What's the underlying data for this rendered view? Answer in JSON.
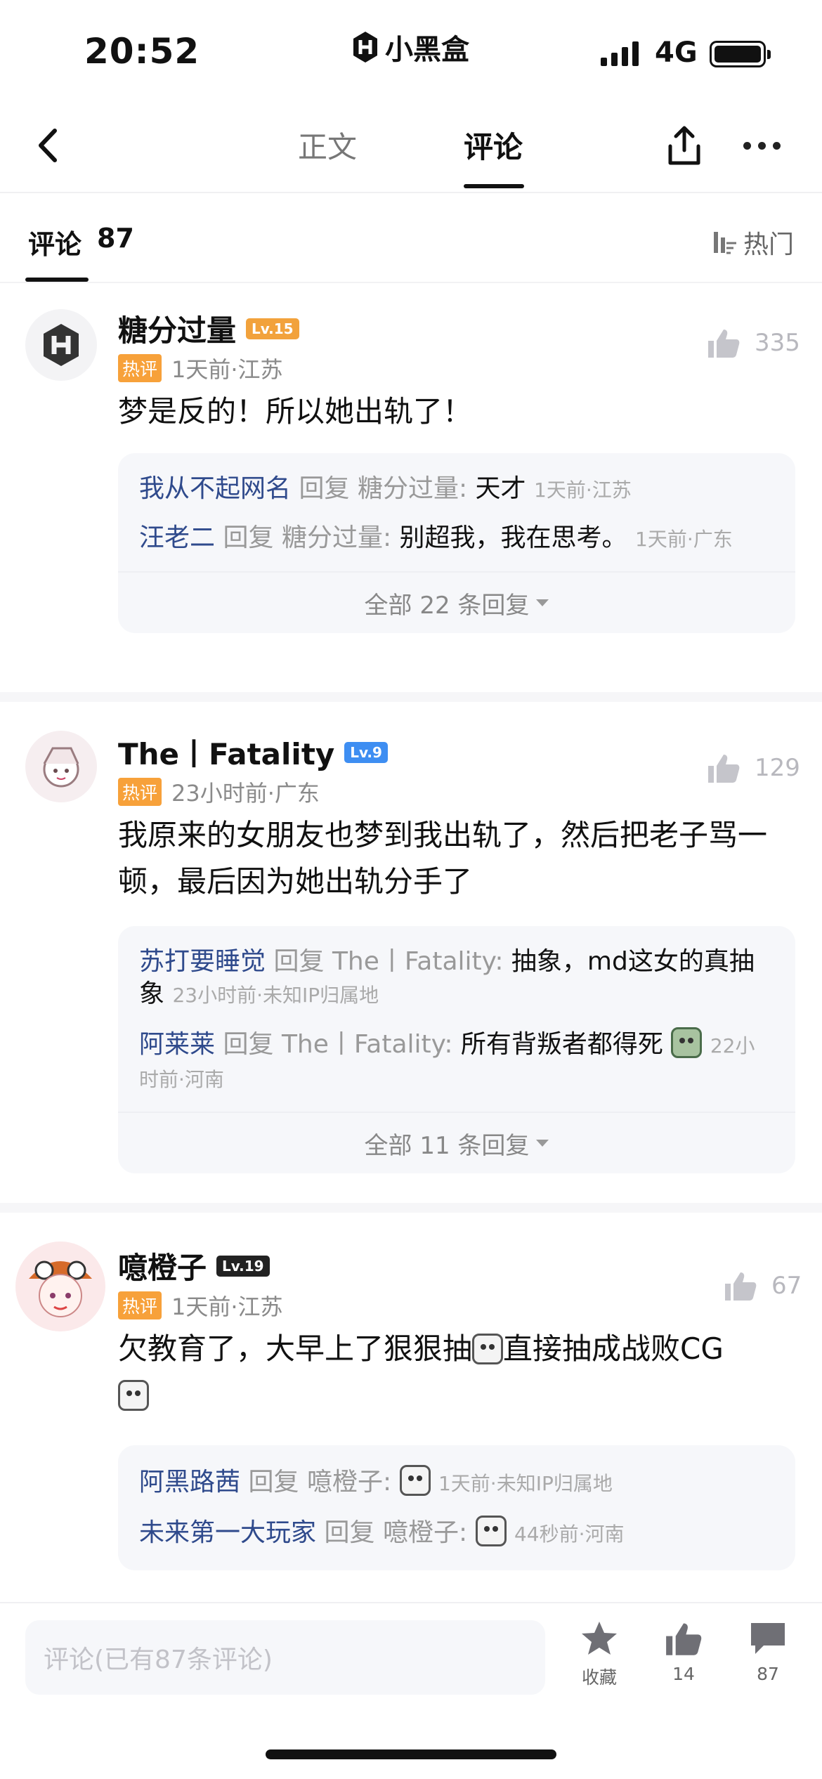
{
  "status": {
    "time": "20:52",
    "app_name": "小黑盒",
    "network": "4G"
  },
  "nav": {
    "tabs": [
      {
        "label": "正文"
      },
      {
        "label": "评论"
      }
    ]
  },
  "comments_header": {
    "title": "评论",
    "count": "87",
    "sort_label": "热门"
  },
  "comments": [
    {
      "username": "糖分过量",
      "level": "Lv.15",
      "level_color": "#f2a23c",
      "hot_label": "热评",
      "time_loc": "1天前·江苏",
      "text": "梦是反的！所以她出轨了！",
      "likes": "335",
      "replies": [
        {
          "user": "我从不起网名",
          "reply_word": "回复",
          "target": "糖分过量:",
          "text": "天才",
          "meta": "1天前·江苏"
        },
        {
          "user": "汪老二",
          "reply_word": "回复",
          "target": "糖分过量:",
          "text": "别超我，我在思考。",
          "meta": "1天前·广东"
        }
      ],
      "more_label": "全部 22 条回复"
    },
    {
      "username": "The丨Fatality",
      "level": "Lv.9",
      "level_color": "#3e8ef2",
      "hot_label": "热评",
      "time_loc": "23小时前·广东",
      "text": "我原来的女朋友也梦到我出轨了，然后把老子骂一顿，最后因为她出轨分手了",
      "likes": "129",
      "replies": [
        {
          "user": "苏打要睡觉",
          "reply_word": "回复",
          "target": "The丨Fatality:",
          "text": "抽象，md这女的真抽象",
          "meta": "23小时前·未知IP归属地"
        },
        {
          "user": "阿莱莱",
          "reply_word": "回复",
          "target": "The丨Fatality:",
          "text": "所有背叛者都得死",
          "meta": "22小时前·河南"
        }
      ],
      "more_label": "全部 11 条回复"
    },
    {
      "username": "噫橙子",
      "level": "Lv.19",
      "level_color": "#222222",
      "hot_label": "热评",
      "time_loc": "1天前·江苏",
      "text_a": "欠教育了，大早上了狠狠抽",
      "text_b": "直接抽成战败CG",
      "likes": "67",
      "replies": [
        {
          "user": "阿黑路茜",
          "reply_word": "回复",
          "target": "噫橙子:",
          "meta": "1天前·未知IP归属地"
        },
        {
          "user": "未来第一大玩家",
          "reply_word": "回复",
          "target": "噫橙子:",
          "meta": "44秒前·河南"
        }
      ]
    }
  ],
  "bottom_bar": {
    "placeholder": "评论(已有87条评论)",
    "favorite_label": "收藏",
    "like_count": "14",
    "comment_count": "87"
  },
  "icons": [
    "back-icon",
    "share-icon",
    "more-icon",
    "sort-icon",
    "thumb-up-icon",
    "star-icon",
    "comment-icon"
  ]
}
